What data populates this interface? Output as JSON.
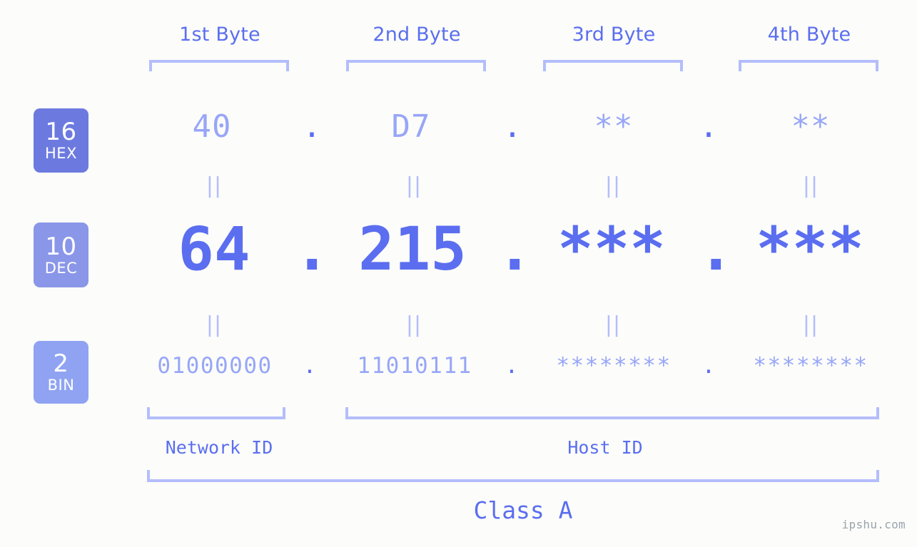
{
  "background_color": "#fcfdfa",
  "accent_color": "#5b6ef0",
  "accent_light": "#98a6f7",
  "bracket_color": "#b4bdfb",
  "byte_headers": [
    {
      "label": "1st Byte"
    },
    {
      "label": "2nd Byte"
    },
    {
      "label": "3rd Byte"
    },
    {
      "label": "4th Byte"
    }
  ],
  "bases": [
    {
      "number": "16",
      "name": "HEX",
      "color": "#6c7ae0"
    },
    {
      "number": "10",
      "name": "DEC",
      "color": "#8a96e8"
    },
    {
      "number": "2",
      "name": "BIN",
      "color": "#8fa3f2"
    }
  ],
  "rows": {
    "hex": {
      "values": [
        "40",
        "D7",
        "**",
        "**"
      ],
      "separator": "."
    },
    "dec": {
      "values": [
        "64",
        "215",
        "***",
        "***"
      ],
      "separator": "."
    },
    "bin": {
      "values": [
        "01000000",
        "11010111",
        "********",
        "********"
      ],
      "separator": "."
    }
  },
  "equals_marks": {
    "glyph": "||",
    "row1": [
      "||",
      "||",
      "||",
      "||"
    ],
    "row2": [
      "||",
      "||",
      "||",
      "||"
    ]
  },
  "sections": [
    {
      "label": "Network ID"
    },
    {
      "label": "Host ID"
    }
  ],
  "class": {
    "label": "Class A"
  },
  "watermark": {
    "text": "ipshu.com"
  }
}
